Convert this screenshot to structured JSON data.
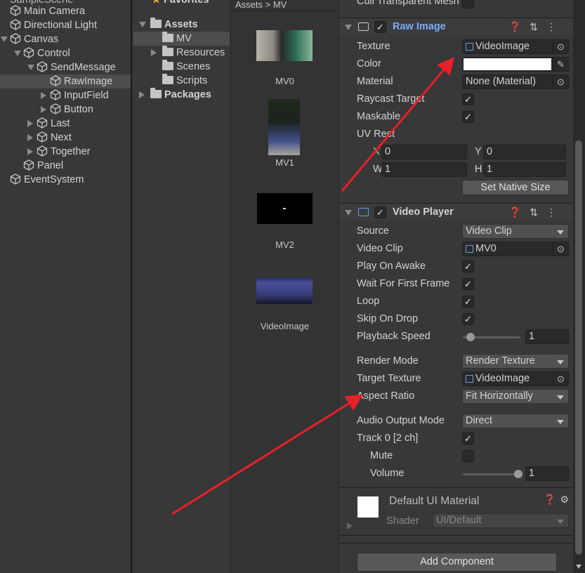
{
  "hierarchy": {
    "scene": "SampleScene",
    "items": [
      {
        "label": "Main Camera",
        "depth": 0,
        "arrow": ""
      },
      {
        "label": "Directional Light",
        "depth": 0,
        "arrow": ""
      },
      {
        "label": "Canvas",
        "depth": 0,
        "arrow": "down"
      },
      {
        "label": "Control",
        "depth": 1,
        "arrow": "down"
      },
      {
        "label": "SendMessage",
        "depth": 2,
        "arrow": "down"
      },
      {
        "label": "RawImage",
        "depth": 3,
        "arrow": "",
        "selected": true
      },
      {
        "label": "InputField",
        "depth": 3,
        "arrow": "right"
      },
      {
        "label": "Button",
        "depth": 3,
        "arrow": "right"
      },
      {
        "label": "Last",
        "depth": 2,
        "arrow": "right"
      },
      {
        "label": "Next",
        "depth": 2,
        "arrow": "right"
      },
      {
        "label": "Together",
        "depth": 2,
        "arrow": "right"
      },
      {
        "label": "Panel",
        "depth": 1,
        "arrow": ""
      },
      {
        "label": "EventSystem",
        "depth": 0,
        "arrow": ""
      }
    ]
  },
  "project": {
    "favorites": "Favorites",
    "breadcrumb": "Assets > MV",
    "tree": [
      {
        "label": "Assets",
        "arrow": "down",
        "bold": true,
        "depth": 0,
        "open": true
      },
      {
        "label": "MV",
        "arrow": "",
        "depth": 1,
        "selected": true
      },
      {
        "label": "Resources",
        "arrow": "right",
        "depth": 1
      },
      {
        "label": "Scenes",
        "arrow": "",
        "depth": 1
      },
      {
        "label": "Scripts",
        "arrow": "",
        "depth": 1
      },
      {
        "label": "Packages",
        "arrow": "right",
        "bold": true,
        "depth": 0
      }
    ],
    "assets": [
      {
        "label": "MV0"
      },
      {
        "label": "MV1"
      },
      {
        "label": "MV2"
      },
      {
        "label": "VideoImage"
      }
    ]
  },
  "inspector": {
    "cull_label": "Cull Transparent Mesh",
    "raw_image": {
      "title": "Raw Image",
      "title_color": "#7cacf8",
      "enabled": true,
      "texture_label": "Texture",
      "texture_value": "VideoImage",
      "color_label": "Color",
      "color_value": "#ffffff",
      "material_label": "Material",
      "material_value": "None (Material)",
      "raycast_label": "Raycast Target",
      "raycast": true,
      "maskable_label": "Maskable",
      "maskable": true,
      "uvrect_label": "UV Rect",
      "x_label": "X",
      "x": "0",
      "y_label": "Y",
      "y": "0",
      "w_label": "W",
      "w": "1",
      "h_label": "H",
      "h": "1",
      "set_native_size": "Set Native Size"
    },
    "video_player": {
      "title": "Video Player",
      "enabled": true,
      "source_label": "Source",
      "source": "Video Clip",
      "clip_label": "Video Clip",
      "clip": "MV0",
      "play_on_awake_label": "Play On Awake",
      "play_on_awake": true,
      "wait_label": "Wait For First Frame",
      "wait": true,
      "loop_label": "Loop",
      "loop": true,
      "skip_label": "Skip On Drop",
      "skip": true,
      "speed_label": "Playback Speed",
      "speed": "1",
      "speed_fraction": 0.1,
      "render_mode_label": "Render Mode",
      "render_mode": "Render Texture",
      "target_label": "Target Texture",
      "target": "VideoImage",
      "aspect_label": "Aspect Ratio",
      "aspect": "Fit Horizontally",
      "audio_label": "Audio Output Mode",
      "audio": "Direct",
      "track_label": "Track 0 [2 ch]",
      "track": true,
      "mute_label": "Mute",
      "mute": false,
      "volume_label": "Volume",
      "volume": "1",
      "volume_fraction": 1.0
    },
    "material": {
      "title": "Default UI Material",
      "shader_label": "Shader",
      "shader": "UI/Default"
    },
    "add_component": "Add Component"
  },
  "annotation_color": "#e8202a"
}
